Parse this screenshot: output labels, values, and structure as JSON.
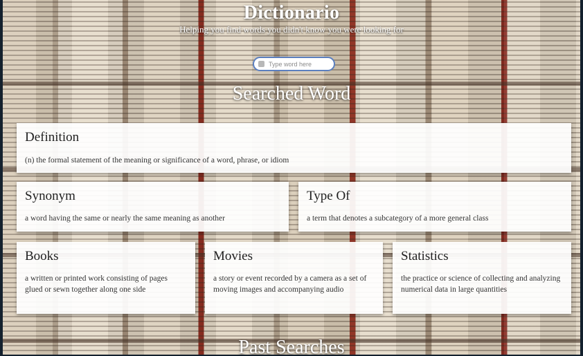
{
  "header": {
    "title": "Dictionario",
    "subtitle": "Helping you find words you didn't know you were looking for"
  },
  "search": {
    "placeholder": "Type word here",
    "value": ""
  },
  "sections": {
    "searched_title": "Searched Word",
    "past_title": "Past Searches"
  },
  "cards": {
    "definition": {
      "title": "Definition",
      "text": "(n) the formal statement of the meaning or significance of a word, phrase, or idiom"
    },
    "synonym": {
      "title": "Synonym",
      "text": "a word having the same or nearly the same meaning as another"
    },
    "type_of": {
      "title": "Type Of",
      "text": "a term that denotes a subcategory of a more general class"
    },
    "books": {
      "title": "Books",
      "text": "a written or printed work consisting of pages glued or sewn together along one side"
    },
    "movies": {
      "title": "Movies",
      "text": "a story or event recorded by a camera as a set of moving images and accompanying audio"
    },
    "statistics": {
      "title": "Statistics",
      "text": "the practice or science of collecting and analyzing numerical data in large quantities"
    }
  },
  "icons": {
    "search": "search-icon"
  },
  "colors": {
    "search_border": "#5b7fbf",
    "card_bg": "#ffffff",
    "heading_text": "#ffffff"
  }
}
